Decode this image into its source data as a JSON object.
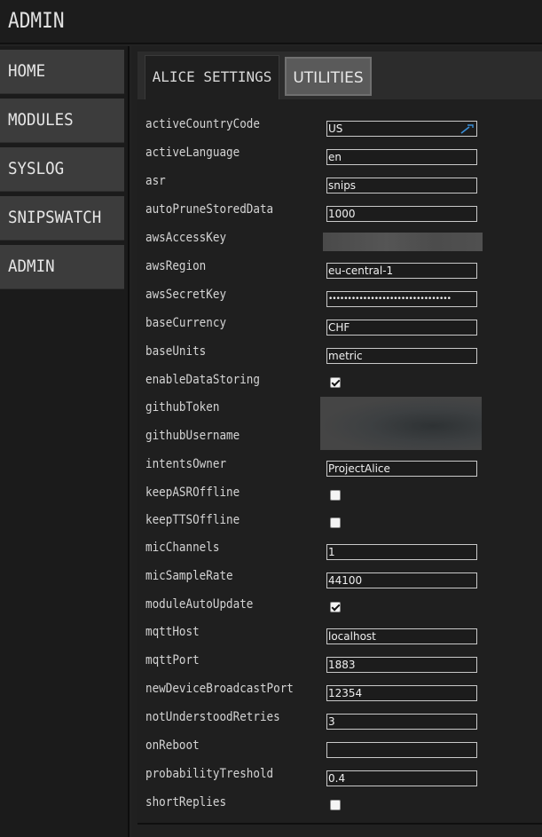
{
  "app": {
    "title": "ADMIN"
  },
  "sidebar": {
    "items": [
      {
        "label": "HOME"
      },
      {
        "label": "MODULES"
      },
      {
        "label": "SYSLOG"
      },
      {
        "label": "SNIPSWATCH"
      },
      {
        "label": "ADMIN"
      }
    ]
  },
  "tabs": [
    {
      "label": "ALICE SETTINGS",
      "active": true
    },
    {
      "label": "UTILITIES",
      "active": false
    }
  ],
  "settings": {
    "activeCountryCode": {
      "label": "activeCountryCode",
      "value": "US"
    },
    "activeLanguage": {
      "label": "activeLanguage",
      "value": "en"
    },
    "asr": {
      "label": "asr",
      "value": "snips"
    },
    "autoPruneStoredData": {
      "label": "autoPruneStoredData",
      "value": "1000"
    },
    "awsAccessKey": {
      "label": "awsAccessKey",
      "value": ""
    },
    "awsRegion": {
      "label": "awsRegion",
      "value": "eu-central-1"
    },
    "awsSecretKey": {
      "label": "awsSecretKey",
      "value": "••••••••••••••••••••••••••••••••"
    },
    "baseCurrency": {
      "label": "baseCurrency",
      "value": "CHF"
    },
    "baseUnits": {
      "label": "baseUnits",
      "value": "metric"
    },
    "enableDataStoring": {
      "label": "enableDataStoring",
      "checked": true
    },
    "githubToken": {
      "label": "githubToken",
      "value": ""
    },
    "githubUsername": {
      "label": "githubUsername",
      "value": ""
    },
    "intentsOwner": {
      "label": "intentsOwner",
      "value": "ProjectAlice"
    },
    "keepASROffline": {
      "label": "keepASROffline",
      "checked": false
    },
    "keepTTSOffline": {
      "label": "keepTTSOffline",
      "checked": false
    },
    "micChannels": {
      "label": "micChannels",
      "value": "1"
    },
    "micSampleRate": {
      "label": "micSampleRate",
      "value": "44100"
    },
    "moduleAutoUpdate": {
      "label": "moduleAutoUpdate",
      "checked": true
    },
    "mqttHost": {
      "label": "mqttHost",
      "value": "localhost"
    },
    "mqttPort": {
      "label": "mqttPort",
      "value": "1883"
    },
    "newDeviceBroadcastPort": {
      "label": "newDeviceBroadcastPort",
      "value": "12354"
    },
    "notUnderstoodRetries": {
      "label": "notUnderstoodRetries",
      "value": "3"
    },
    "onReboot": {
      "label": "onReboot",
      "value": ""
    },
    "probabilityTreshold": {
      "label": "probabilityTreshold",
      "value": "0.4"
    },
    "shortReplies": {
      "label": "shortReplies",
      "checked": false
    }
  },
  "icons": {
    "password_manager": "key-icon"
  },
  "colors": {
    "background": "#222222",
    "nav_item": "#3c3c3c",
    "input_border": "#c9c9c9",
    "key_icon": "#3a8fd8"
  }
}
